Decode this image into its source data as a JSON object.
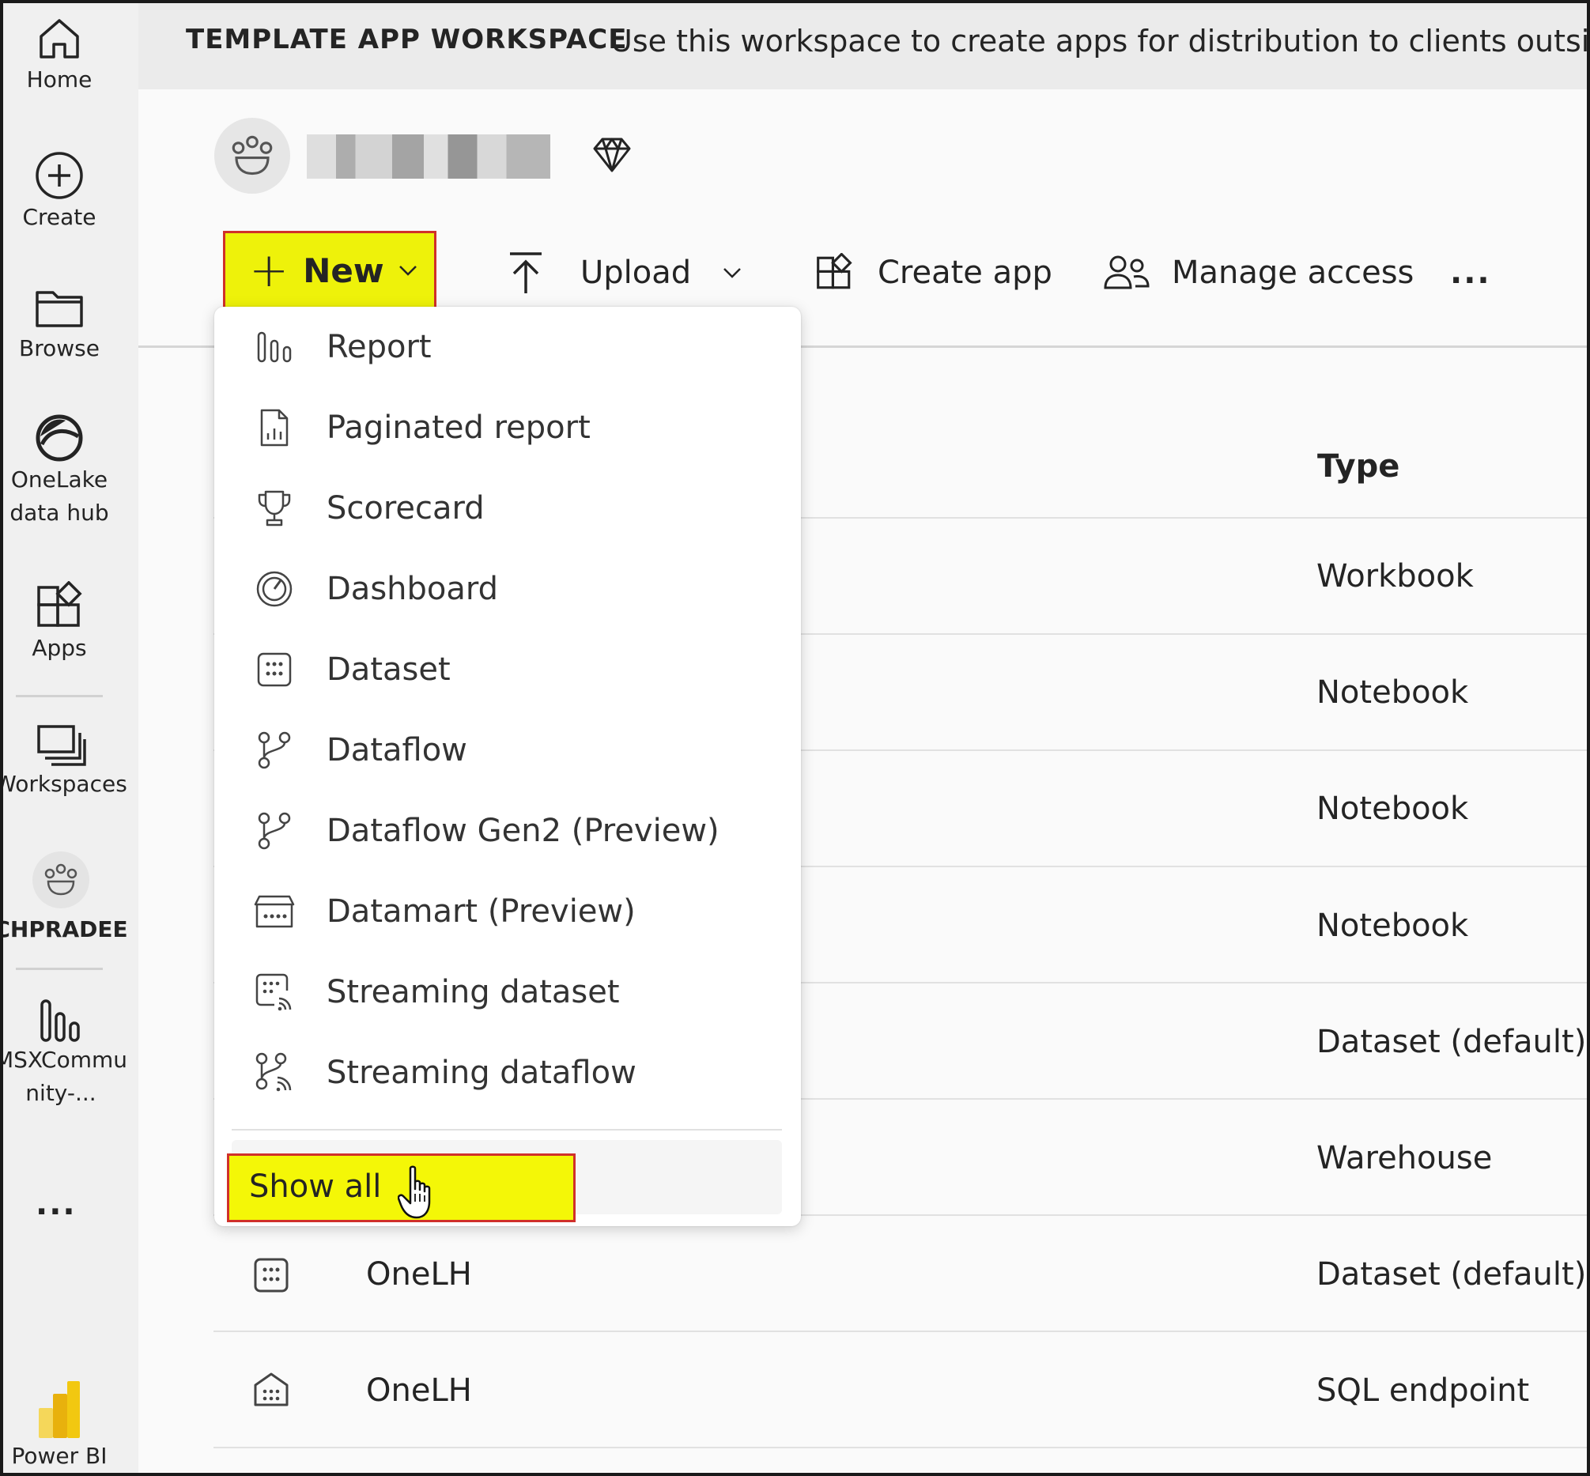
{
  "banner": {
    "title": "TEMPLATE APP WORKSPACE",
    "description": "Use this workspace to create apps for distribution to clients outside"
  },
  "rail": {
    "home": "Home",
    "create": "Create",
    "browse": "Browse",
    "onelake_line1": "OneLake",
    "onelake_line2": "data hub",
    "apps": "Apps",
    "workspaces": "Workspaces",
    "current_workspace": "CHPRADEE",
    "report_line1": "MSXCommu",
    "report_line2": "nity-...",
    "more": "...",
    "powerbi": "Power BI"
  },
  "toolbar": {
    "new": "New",
    "upload": "Upload",
    "create_app": "Create app",
    "manage_access": "Manage access",
    "more": "..."
  },
  "menu": {
    "items": [
      {
        "label": "Report",
        "icon": "report-icon"
      },
      {
        "label": "Paginated report",
        "icon": "paginated-report-icon"
      },
      {
        "label": "Scorecard",
        "icon": "trophy-icon"
      },
      {
        "label": "Dashboard",
        "icon": "gauge-icon"
      },
      {
        "label": "Dataset",
        "icon": "dataset-icon"
      },
      {
        "label": "Dataflow",
        "icon": "dataflow-icon"
      },
      {
        "label": "Dataflow Gen2 (Preview)",
        "icon": "dataflow-icon"
      },
      {
        "label": "Datamart (Preview)",
        "icon": "datamart-icon"
      },
      {
        "label": "Streaming dataset",
        "icon": "streaming-dataset-icon"
      },
      {
        "label": "Streaming dataflow",
        "icon": "streaming-dataflow-icon"
      }
    ],
    "show_all": "Show all"
  },
  "table": {
    "type_header": "Type",
    "rows": [
      {
        "name": "",
        "type": "Workbook"
      },
      {
        "name": "",
        "type": "Notebook"
      },
      {
        "name": "",
        "type": "Notebook"
      },
      {
        "name": "",
        "type": "Notebook"
      },
      {
        "name": "",
        "type": "Dataset (default)"
      },
      {
        "name": "",
        "type": "Warehouse"
      },
      {
        "name": "OneLH",
        "type": "Dataset (default)"
      },
      {
        "name": "OneLH",
        "type": "SQL endpoint"
      }
    ]
  },
  "colors": {
    "highlight": "#eef20a",
    "highlight_border": "#d0302a",
    "rail_bg": "#f0f0f0",
    "powerbi_yellow": "#f2c811"
  }
}
